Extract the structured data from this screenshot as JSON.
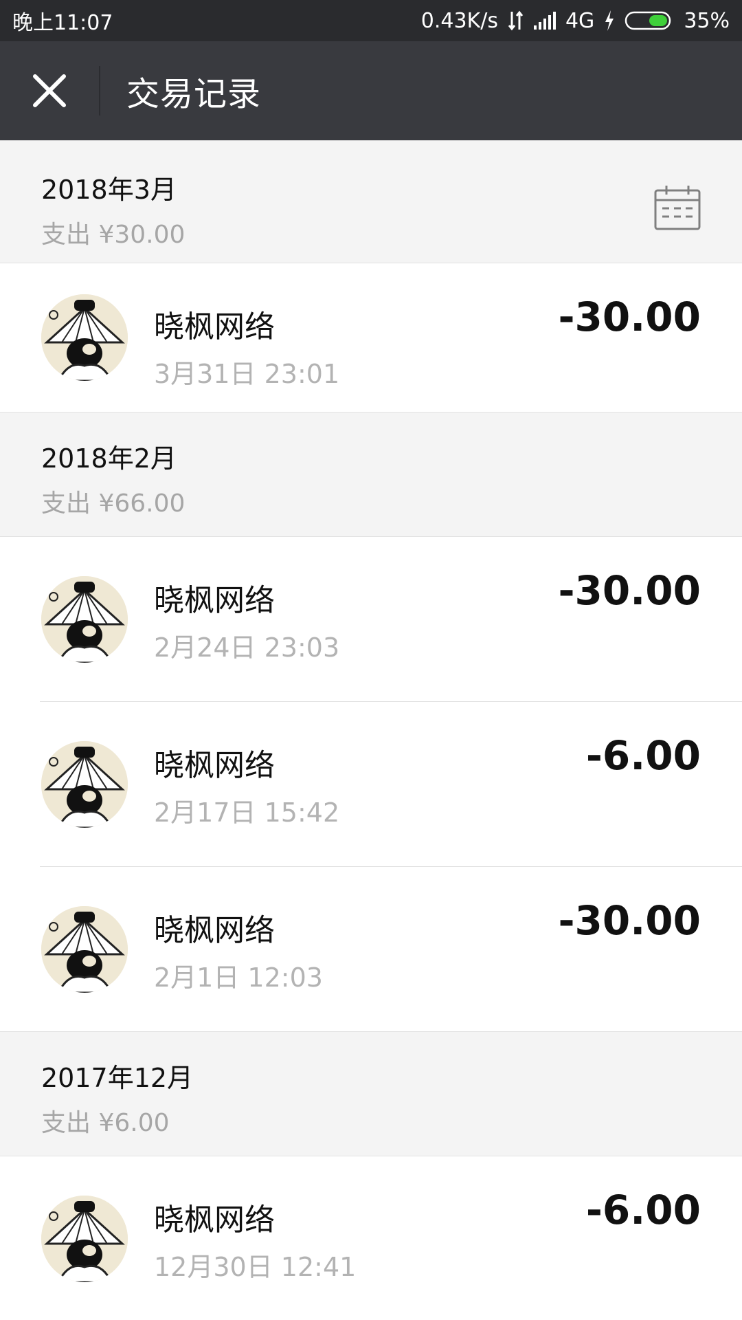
{
  "status_bar": {
    "time": "晚上11:07",
    "speed": "0.43K/s",
    "network": "4G",
    "battery": "35%"
  },
  "header": {
    "title": "交易记录",
    "close_icon": "close-icon"
  },
  "groups": [
    {
      "month": "2018年3月",
      "total": "支出 ¥30.00",
      "transactions": [
        {
          "merchant": "晓枫网络",
          "time": "3月31日 23:01",
          "amount": "-30.00"
        }
      ]
    },
    {
      "month": "2018年2月",
      "total": "支出 ¥66.00",
      "transactions": [
        {
          "merchant": "晓枫网络",
          "time": "2月24日 23:03",
          "amount": "-30.00"
        },
        {
          "merchant": "晓枫网络",
          "time": "2月17日 15:42",
          "amount": "-6.00"
        },
        {
          "merchant": "晓枫网络",
          "time": "2月1日 12:03",
          "amount": "-30.00"
        }
      ]
    },
    {
      "month": "2017年12月",
      "total": "支出 ¥6.00",
      "transactions": [
        {
          "merchant": "晓枫网络",
          "time": "12月30日 12:41",
          "amount": "-6.00"
        }
      ]
    }
  ]
}
